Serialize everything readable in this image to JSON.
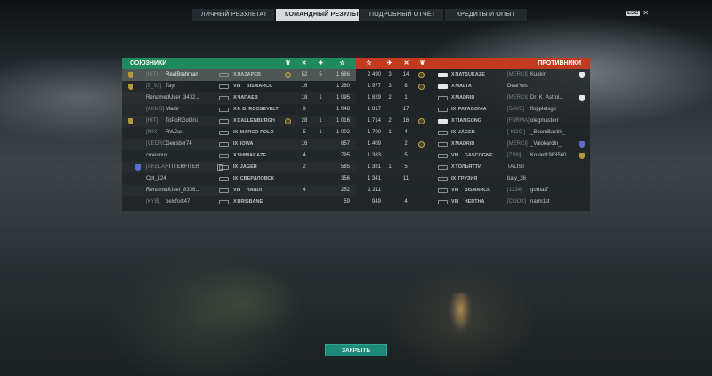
{
  "tabs": [
    {
      "label": "ЛИЧНЫЙ РЕЗУЛЬТАТ",
      "active": false
    },
    {
      "label": "КОМАНДНЫЙ РЕЗУЛЬТАТ",
      "active": true
    },
    {
      "label": "ПОДРОБНЫЙ ОТЧЁТ",
      "active": false
    },
    {
      "label": "КРЕДИТЫ И ОПЫТ",
      "active": false
    }
  ],
  "esc": {
    "key": "ESC",
    "close_glyph": "✕"
  },
  "allies": {
    "title": "СОЮЗНИКИ",
    "header_icons": [
      "laurel-icon",
      "frag-icon",
      "plane-icon",
      "star-icon"
    ],
    "rows": [
      {
        "clan": "[HIT]",
        "nick": "RealBrahman",
        "tier": "X",
        "ship": "ЛАЗАРЕВ",
        "frags": "52",
        "planes": "5",
        "xp": "1 686",
        "flag": "gold",
        "medal": true,
        "me": true
      },
      {
        "clan": "[Z_92]",
        "nick": "Tayr",
        "tier": "VIII",
        "ship": "BISMARCK",
        "frags": "16",
        "planes": "",
        "xp": "1 260",
        "flag": "gold"
      },
      {
        "clan": "",
        "nick": "RenamedUser_3402...",
        "tier": "X",
        "ship": "ЧАПАЕВ",
        "frags": "18",
        "planes": "1",
        "xp": "1 095"
      },
      {
        "clan": "[AKMS]",
        "nick": "Madir",
        "tier": "X",
        "ship": "F. D. ROOSEVELT",
        "frags": "9",
        "planes": "",
        "xp": "1 048"
      },
      {
        "clan": "[HIT]",
        "nick": "ToPoRGoDrU",
        "tier": "X",
        "ship": "CALLENBURGH",
        "frags": "28",
        "planes": "1",
        "xp": "1 016",
        "flag": "gold",
        "medal": true
      },
      {
        "clan": "[MIX]",
        "nick": "RWJan",
        "tier": "IX",
        "ship": "MARCO POLO",
        "frags": "5",
        "planes": "1",
        "xp": "1 002"
      },
      {
        "clan": "[VEDRO]",
        "nick": "Gensber74",
        "tier": "IX",
        "ship": "IOWA",
        "frags": "16",
        "planes": "",
        "xp": "857"
      },
      {
        "clan": "",
        "nick": "cmennuy",
        "tier": "X",
        "ship": "SHIMAKAZE",
        "frags": "4",
        "planes": "",
        "xp": "795"
      },
      {
        "clan": "[AKELA]",
        "nick": "FITTERFITER",
        "tier": "IX",
        "ship": "JÄGER",
        "frags": "2",
        "planes": "",
        "xp": "585",
        "flag": "blue",
        "rank": true
      },
      {
        "clan": "",
        "nick": "Cpt_124",
        "tier": "IX",
        "ship": "СВЕРДЛОВСК",
        "frags": "",
        "planes": "",
        "xp": "356"
      },
      {
        "clan": "",
        "nick": "RenamedUser_8306...",
        "tier": "VIII",
        "ship": "HANDI",
        "frags": "4",
        "planes": "",
        "xp": "252"
      },
      {
        "clan": "[KYB]",
        "nick": "belcfost47",
        "tier": "X",
        "ship": "BRISBANE",
        "frags": "",
        "planes": "",
        "xp": "59"
      }
    ]
  },
  "enemies": {
    "title": "ПРОТИВНИКИ",
    "header_icons": [
      "star-icon",
      "plane-icon",
      "frag-icon",
      "laurel-icon"
    ],
    "rows": [
      {
        "xp": "2 490",
        "planes": "3",
        "frags": "14",
        "medal": true,
        "tier": "X",
        "ship": "NATSUKAZE",
        "clan": "[MERCI]",
        "nick": "Kuskin",
        "flag": "white",
        "shipHi": true
      },
      {
        "xp": "1 977",
        "planes": "3",
        "frags": "8",
        "medal": true,
        "tier": "X",
        "ship": "MALTA",
        "clan": "",
        "nick": "DearYes",
        "shipHi": true
      },
      {
        "xp": "1 829",
        "planes": "2",
        "frags": "1",
        "medal": false,
        "tier": "X",
        "ship": "MADRID",
        "clan": "[MERCI]",
        "nick": "Dr_K_Astrol...",
        "flag": "white"
      },
      {
        "xp": "1 817",
        "planes": "",
        "frags": "17",
        "medal": false,
        "tier": "IX",
        "ship": "PATAGONIA",
        "clan": "[SAVE]",
        "nick": "floppletsgo"
      },
      {
        "xp": "1 714",
        "planes": "2",
        "frags": "16",
        "medal": true,
        "tier": "X",
        "ship": "TIANGONG",
        "clan": "[FURMA]",
        "nick": "olegmasterr",
        "shipHi": true
      },
      {
        "xp": "1 700",
        "planes": "1",
        "frags": "4",
        "medal": false,
        "tier": "IX",
        "ship": "JÄGER",
        "clan": "[-KOC-]",
        "nick": "_BoomBastik_"
      },
      {
        "xp": "1 409",
        "planes": "",
        "frags": "2",
        "medal": true,
        "tier": "X",
        "ship": "MADRID",
        "clan": "[MERCI]",
        "nick": "_Valokardin_",
        "flag": "blue"
      },
      {
        "xp": "1 383",
        "planes": "",
        "frags": "5",
        "medal": false,
        "tier": "VIII",
        "ship": "GASCOGNE",
        "clan": "[ZSN]",
        "nick": "Kostet1983560",
        "flag": "gold"
      },
      {
        "xp": "1 381",
        "planes": "1",
        "frags": "5",
        "medal": false,
        "tier": "X",
        "ship": "ТОЛЬЯТТИ",
        "clan": "",
        "nick": "TALIST"
      },
      {
        "xp": "1 341",
        "planes": "",
        "frags": "11",
        "medal": false,
        "tier": "IX",
        "ship": "ГРУЗИЯ",
        "clan": "",
        "nick": "baly_36"
      },
      {
        "xp": "1 211",
        "planes": "",
        "frags": "",
        "medal": false,
        "tier": "VIII",
        "ship": "BISMARCK",
        "clan": "[1234]",
        "nick": "gorbat7"
      },
      {
        "xp": "949",
        "planes": "",
        "frags": "4",
        "medal": false,
        "tier": "VIII",
        "ship": "HERTHA",
        "clan": "[COOK]",
        "nick": "narm1st"
      }
    ]
  },
  "close_button": {
    "label": "ЗАКРЫТЬ"
  },
  "colors": {
    "allies": "#1f8a5d",
    "enemies": "#c23a20",
    "close": "#1e8b7a"
  }
}
